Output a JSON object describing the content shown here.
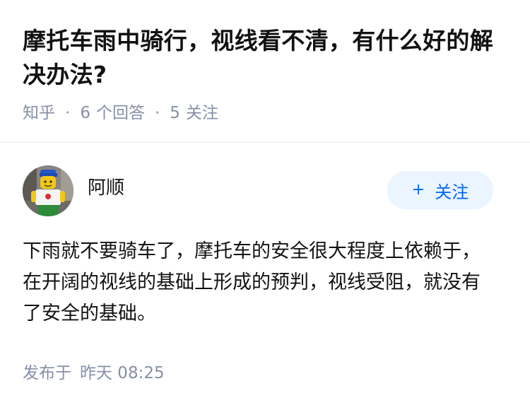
{
  "question": {
    "title": "摩托车雨中骑行，视线看不清，有什么好的解决办法?",
    "source": "知乎",
    "separator": "·",
    "answers_count": "6",
    "answers_label": "个回答",
    "followers_count": "5",
    "followers_label": "关注"
  },
  "answer": {
    "author": {
      "name": "阿顺",
      "avatar_icon": "lego-minifigure-avatar"
    },
    "follow_button": {
      "icon": "plus-icon",
      "label": "关注"
    },
    "content": "下雨就不要骑车了，摩托车的安全很大程度上依赖于，在开阔的视线的基础上形成的预判，视线受阻，就没有了安全的基础。",
    "published_label": "发布于",
    "published_time": "昨天 08:25"
  },
  "colors": {
    "text_primary": "#121212",
    "text_secondary": "#8590a6",
    "accent_blue": "#0066ff",
    "follow_bg": "#ebf5ff",
    "divider": "#f0f2f7"
  }
}
